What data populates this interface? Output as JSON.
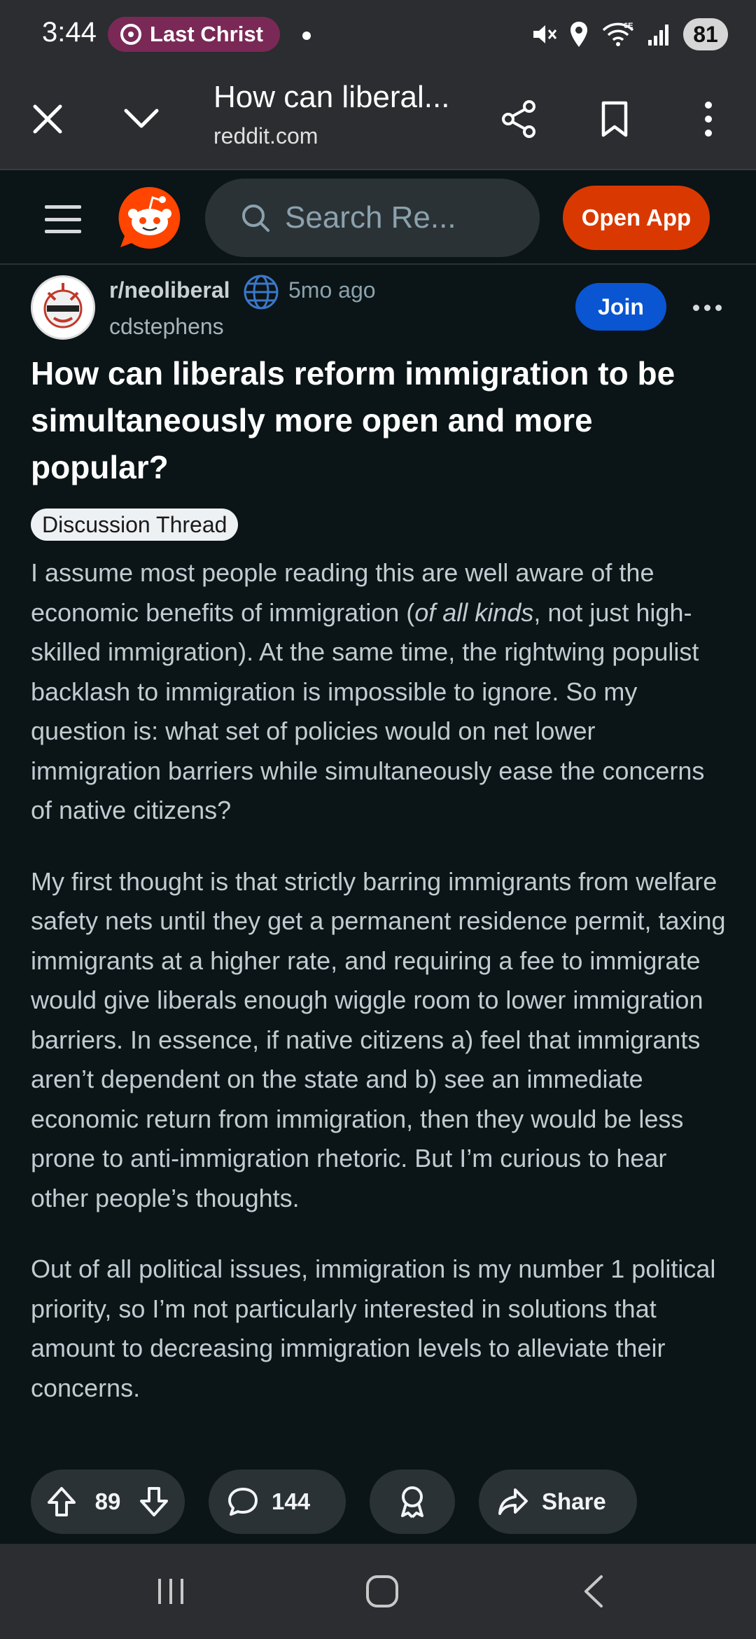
{
  "status_bar": {
    "time": "3:44",
    "media_pill_text": "Last Christ",
    "network_label": "6E",
    "battery": "81"
  },
  "browser": {
    "tab_title": "How can liberal...",
    "url": "reddit.com"
  },
  "reddit_header": {
    "search_placeholder": "Search Re...",
    "open_app_label": "Open App",
    "accent_color": "#d93900"
  },
  "post": {
    "subreddit": "r/neoliberal",
    "time_ago": "5mo ago",
    "author": "cdstephens",
    "join_label": "Join",
    "title": "How can liberals reform immigration to be simultaneously more open and more popular?",
    "flair": "Discussion Thread",
    "body": {
      "p1_before_italic": "I assume most people reading this are well aware of the economic benefits of immigration (",
      "p1_italic": "of all kinds",
      "p1_after_italic": ", not just high-skilled immigration). At the same time, the rightwing populist backlash to immigration is impossible to ignore. So my question is: what set of policies would on net lower immigration barriers while simultaneously ease the concerns of native citizens?",
      "p2": "My first thought is that strictly barring immigrants from welfare safety nets until they get a permanent residence permit, taxing immigrants at a higher rate, and requiring a fee to immigrate would give liberals enough wiggle room to lower immigration barriers. In essence, if native citizens a) feel that immigrants aren’t dependent on the state and b) see an immediate economic return from immigration, then they would be less prone to anti-immigration rhetoric. But I’m curious to hear other people’s thoughts.",
      "p3": "Out of all political issues, immigration is my number 1 political priority, so I’m not particularly interested in solutions that amount to decreasing immigration levels to alleviate their concerns."
    }
  },
  "actions": {
    "votes": "89",
    "comments": "144",
    "share_label": "Share"
  }
}
